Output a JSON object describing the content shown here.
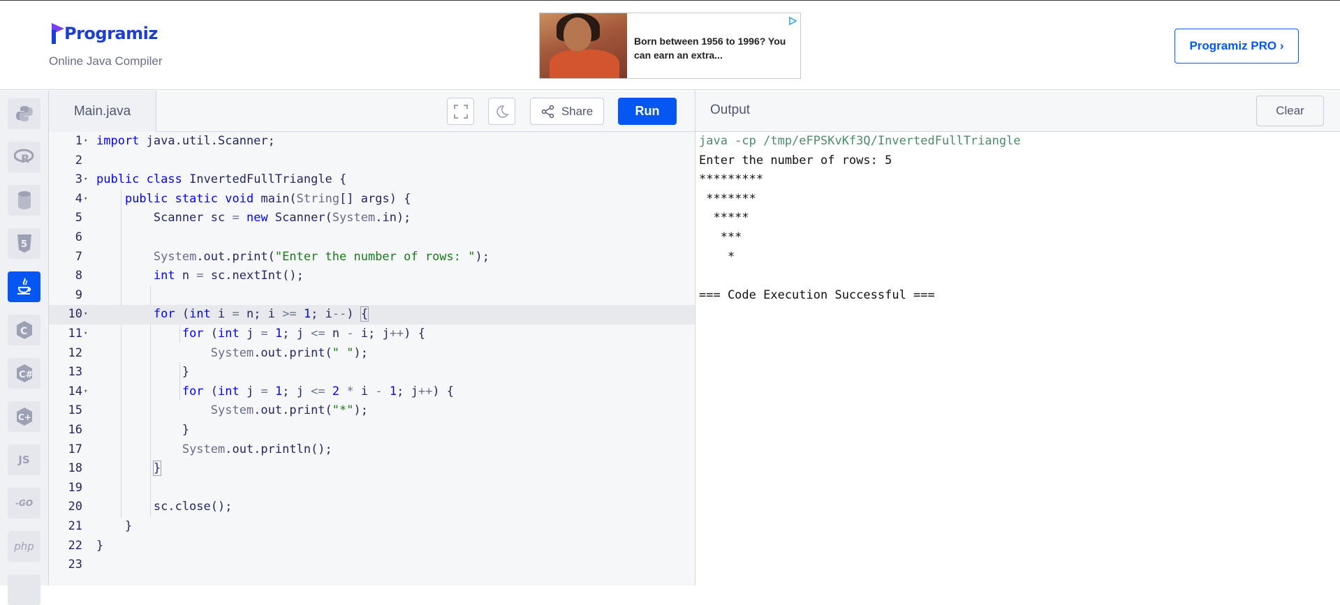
{
  "header": {
    "logo_text": "Programiz",
    "subtitle": "Online Java Compiler",
    "ad_text": "Born between 1956 to 1996? You can earn an extra...",
    "pro_button": "Programiz PRO ›"
  },
  "sidebar": {
    "languages": [
      {
        "name": "python-icon",
        "label": ""
      },
      {
        "name": "r-icon",
        "label": ""
      },
      {
        "name": "sql-icon",
        "label": ""
      },
      {
        "name": "html5-icon",
        "label": ""
      },
      {
        "name": "java-icon",
        "label": "",
        "active": true
      },
      {
        "name": "c-icon",
        "label": ""
      },
      {
        "name": "csharp-icon",
        "label": ""
      },
      {
        "name": "cpp-icon",
        "label": ""
      },
      {
        "name": "javascript-icon",
        "label": "JS"
      },
      {
        "name": "go-icon",
        "label": "-GO"
      },
      {
        "name": "php-icon",
        "label": "php"
      }
    ]
  },
  "editor": {
    "tab_label": "Main.java",
    "share_label": "Share",
    "run_label": "Run",
    "lines": [
      "1",
      "2",
      "3",
      "4",
      "5",
      "6",
      "7",
      "8",
      "9",
      "10",
      "11",
      "12",
      "13",
      "14",
      "15",
      "16",
      "17",
      "18",
      "19",
      "20",
      "21",
      "22",
      "23"
    ]
  },
  "output": {
    "title": "Output",
    "clear_label": "Clear",
    "lines": [
      "java -cp /tmp/eFPSKvKf3Q/InvertedFullTriangle",
      "Enter the number of rows: 5",
      "*********",
      " *******",
      "  *****",
      "   ***",
      "    *",
      "",
      "=== Code Execution Successful ==="
    ]
  },
  "colors": {
    "accent": "#0556f3",
    "logo": "#1a3ed6",
    "keyword": "#0000ff",
    "string": "#1a7a1a"
  }
}
